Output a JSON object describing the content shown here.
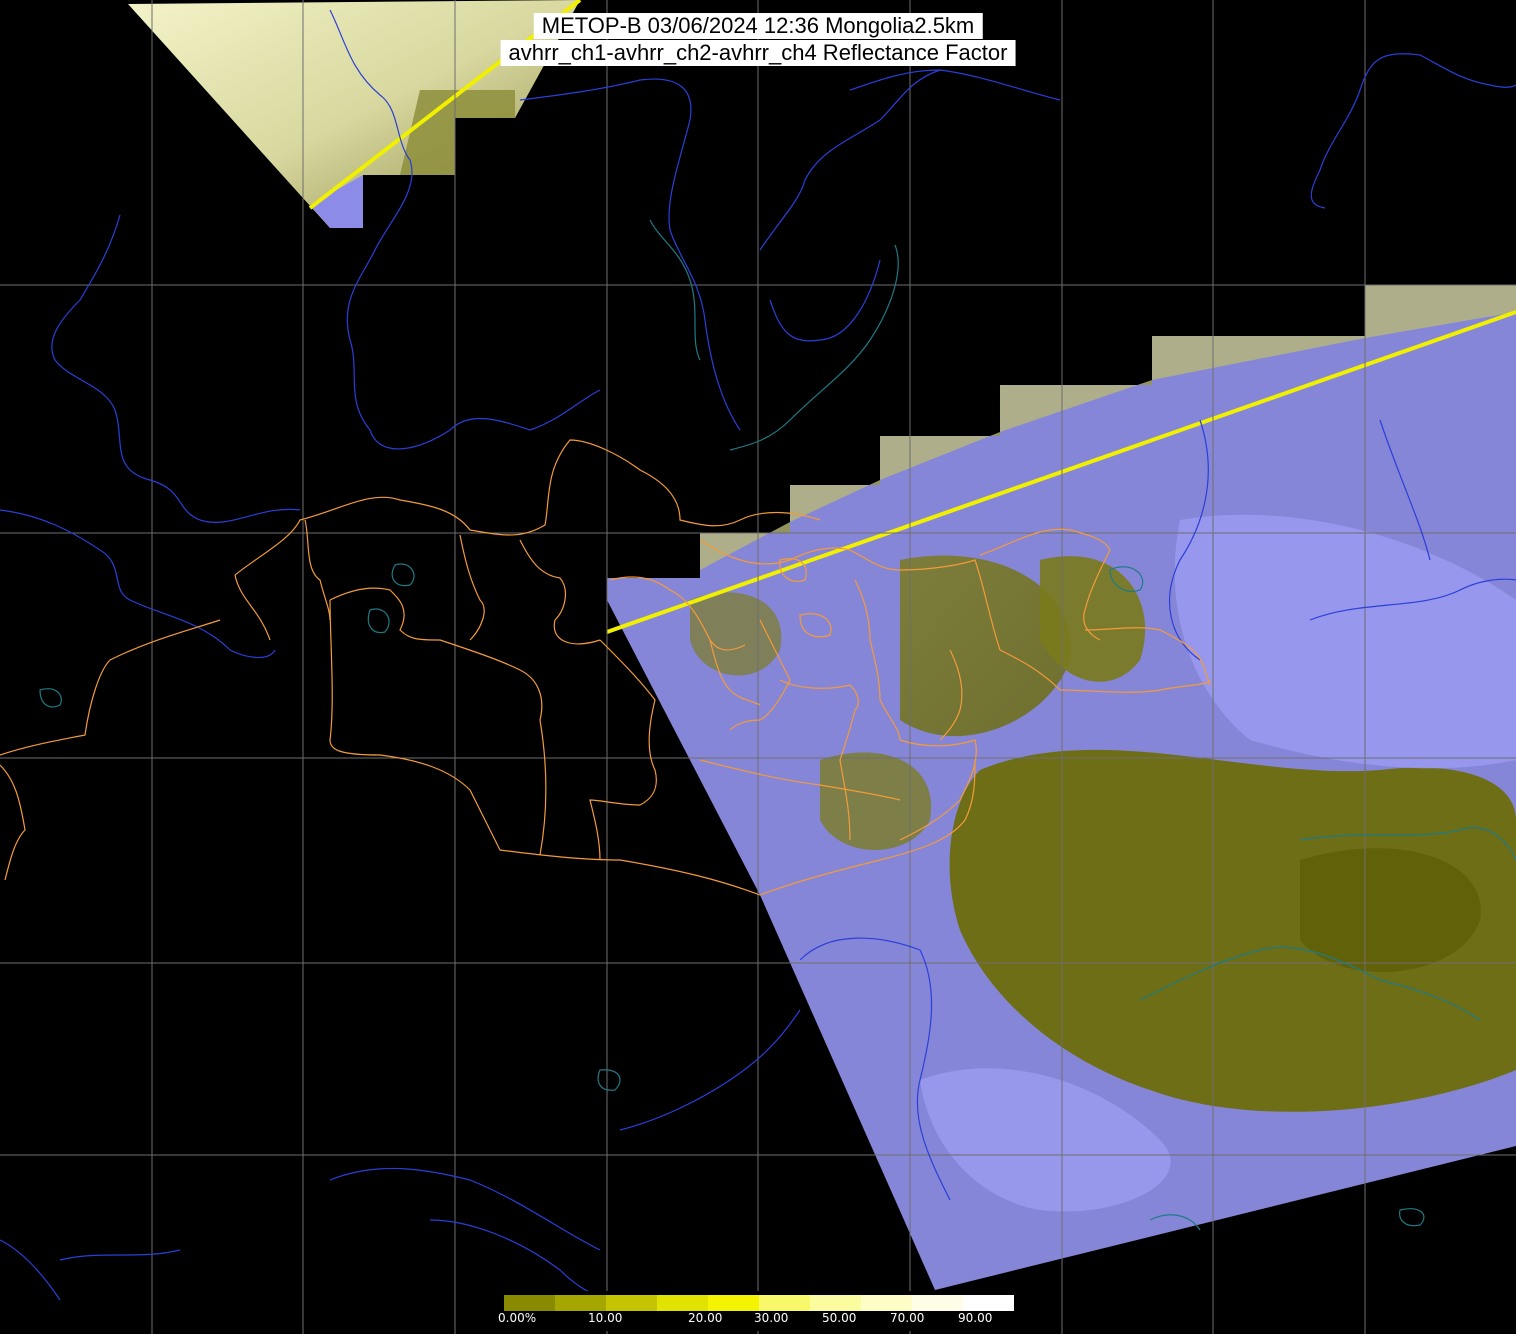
{
  "title": {
    "line1": "METOP-B 03/06/2024 12:36 Mongolia2.5km",
    "line2": "avhrr_ch1-avhrr_ch2-avhrr_ch4 Reflectance Factor"
  },
  "colorbar": {
    "labels": [
      "0.00%",
      "10.00",
      "20.00",
      "30.00",
      "50.00",
      "70.00",
      "90.00"
    ],
    "colors": [
      "#8a8a00",
      "#a6a600",
      "#c4c400",
      "#e2e200",
      "#f4f400",
      "#f8f86a",
      "#fbfba0",
      "#fdfdc8",
      "#fefee6",
      "#ffffff"
    ]
  },
  "colors": {
    "background": "#000000",
    "grid": "#6e6e6e",
    "coast": "#2a3fd8",
    "lake": "#1f7a85",
    "border": "#f39b3a",
    "clear_land": "#6f6f12",
    "cloud": "#8c8ce8",
    "swath_edge": "#f0f000"
  }
}
